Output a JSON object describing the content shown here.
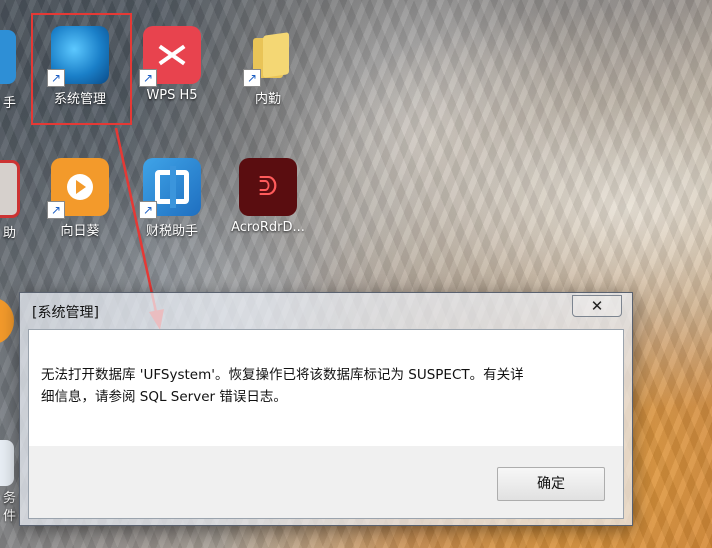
{
  "desktop": {
    "icons": [
      {
        "label": "系统管理",
        "icon": "system-management-icon"
      },
      {
        "label": "WPS H5",
        "icon": "wps-h5-icon"
      },
      {
        "label": "内勤",
        "icon": "folder-icon"
      },
      {
        "label": "向日葵",
        "icon": "sunflower-icon"
      },
      {
        "label": "财税助手",
        "icon": "tax-assistant-icon"
      },
      {
        "label": "AcroRdrD...",
        "icon": "acrobat-reader-icon"
      }
    ],
    "edge_labels": [
      "手",
      "助",
      "务",
      "件"
    ]
  },
  "annotation": {
    "color": "#e53935"
  },
  "dialog": {
    "title": "[系统管理]",
    "close_glyph": "✕",
    "message_line1": "无法打开数据库 'UFSystem'。恢复操作已将该数据库标记为 SUSPECT。有关详",
    "message_line2": "细信息，请参阅 SQL Server 错误日志。",
    "ok_label": "确定"
  }
}
